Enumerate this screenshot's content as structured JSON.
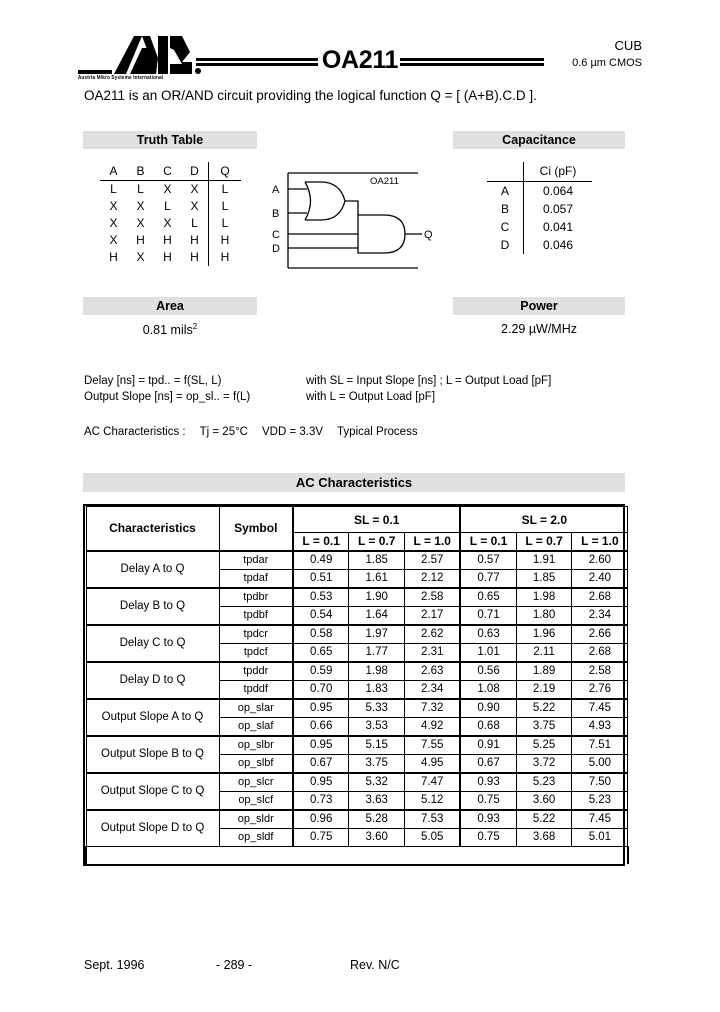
{
  "header": {
    "logo_alt": "AMS",
    "logo_subtitle": "Austria Mikro Systeme International",
    "part_number": "OA211",
    "family": "CUB",
    "process": "0.6 µm CMOS"
  },
  "intro": {
    "text": "OA211 is an OR/AND circuit providing the logical function Q = [ (A+B).C.D ]."
  },
  "sections": {
    "truth_table_title": "Truth Table",
    "capacitance_title": "Capacitance",
    "area_title": "Area",
    "power_title": "Power",
    "ac_title": "AC Characteristics"
  },
  "truth_table": {
    "headers": [
      "A",
      "B",
      "C",
      "D",
      "Q"
    ],
    "rows": [
      [
        "L",
        "L",
        "X",
        "X",
        "L"
      ],
      [
        "X",
        "X",
        "L",
        "X",
        "L"
      ],
      [
        "X",
        "X",
        "X",
        "L",
        "L"
      ],
      [
        "X",
        "H",
        "H",
        "H",
        "H"
      ],
      [
        "H",
        "X",
        "H",
        "H",
        "H"
      ]
    ]
  },
  "capacitance": {
    "value_header": "Ci (pF)",
    "rows": [
      {
        "pin": "A",
        "value": "0.064"
      },
      {
        "pin": "B",
        "value": "0.057"
      },
      {
        "pin": "C",
        "value": "0.041"
      },
      {
        "pin": "D",
        "value": "0.046"
      }
    ]
  },
  "circuit": {
    "label": "OA211",
    "inputs": [
      "A",
      "B",
      "C",
      "D"
    ],
    "output": "Q"
  },
  "area": {
    "value": "0.81  mils",
    "exponent": "2"
  },
  "power": {
    "value": "2.29 µW/MHz"
  },
  "notes": {
    "line1_left": "Delay [ns]  =  tpd..  =  f(SL, L)",
    "line1_right": "with  SL = Input Slope [ns] ;  L = Output Load [pF]",
    "line2_left": "Output Slope [ns]  =  op_sl..  =  f(L)",
    "line2_right": "with  L = Output Load [pF]",
    "ac_conditions_label": "AC Characteristics :",
    "ac_temp": "Tj = 25°C",
    "ac_vdd": "VDD = 3.3V",
    "ac_process": "Typical Process"
  },
  "ac_table": {
    "col_characteristics": "Characteristics",
    "col_symbol": "Symbol",
    "group1": "SL = 0.1",
    "group2": "SL = 2.0",
    "subcols": [
      "L = 0.1",
      "L = 0.7",
      "L = 1.0"
    ],
    "rows": [
      {
        "characteristic": "Delay A to Q",
        "sub": [
          {
            "symbol": "tpdar",
            "v": [
              "0.49",
              "1.85",
              "2.57",
              "0.57",
              "1.91",
              "2.60"
            ]
          },
          {
            "symbol": "tpdaf",
            "v": [
              "0.51",
              "1.61",
              "2.12",
              "0.77",
              "1.85",
              "2.40"
            ]
          }
        ]
      },
      {
        "characteristic": "Delay B to Q",
        "sub": [
          {
            "symbol": "tpdbr",
            "v": [
              "0.53",
              "1.90",
              "2.58",
              "0.65",
              "1.98",
              "2.68"
            ]
          },
          {
            "symbol": "tpdbf",
            "v": [
              "0.54",
              "1.64",
              "2.17",
              "0.71",
              "1.80",
              "2.34"
            ]
          }
        ]
      },
      {
        "characteristic": "Delay C to Q",
        "sub": [
          {
            "symbol": "tpdcr",
            "v": [
              "0.58",
              "1.97",
              "2.62",
              "0.63",
              "1.96",
              "2.66"
            ]
          },
          {
            "symbol": "tpdcf",
            "v": [
              "0.65",
              "1.77",
              "2.31",
              "1.01",
              "2.11",
              "2.68"
            ]
          }
        ]
      },
      {
        "characteristic": "Delay D to Q",
        "sub": [
          {
            "symbol": "tpddr",
            "v": [
              "0.59",
              "1.98",
              "2.63",
              "0.56",
              "1.89",
              "2.58"
            ]
          },
          {
            "symbol": "tpddf",
            "v": [
              "0.70",
              "1.83",
              "2.34",
              "1.08",
              "2.19",
              "2.76"
            ]
          }
        ]
      },
      {
        "characteristic": "Output Slope A to Q",
        "sub": [
          {
            "symbol": "op_slar",
            "v": [
              "0.95",
              "5.33",
              "7.32",
              "0.90",
              "5.22",
              "7.45"
            ]
          },
          {
            "symbol": "op_slaf",
            "v": [
              "0.66",
              "3.53",
              "4.92",
              "0.68",
              "3.75",
              "4.93"
            ]
          }
        ]
      },
      {
        "characteristic": "Output Slope B to Q",
        "sub": [
          {
            "symbol": "op_slbr",
            "v": [
              "0.95",
              "5.15",
              "7.55",
              "0.91",
              "5.25",
              "7.51"
            ]
          },
          {
            "symbol": "op_slbf",
            "v": [
              "0.67",
              "3.75",
              "4.95",
              "0.67",
              "3.72",
              "5.00"
            ]
          }
        ]
      },
      {
        "characteristic": "Output Slope C to Q",
        "sub": [
          {
            "symbol": "op_slcr",
            "v": [
              "0.95",
              "5.32",
              "7.47",
              "0.93",
              "5.23",
              "7.50"
            ]
          },
          {
            "symbol": "op_slcf",
            "v": [
              "0.73",
              "3.63",
              "5.12",
              "0.75",
              "3.60",
              "5.23"
            ]
          }
        ]
      },
      {
        "characteristic": "Output Slope D to Q",
        "sub": [
          {
            "symbol": "op_sldr",
            "v": [
              "0.96",
              "5.28",
              "7.53",
              "0.93",
              "5.22",
              "7.45"
            ]
          },
          {
            "symbol": "op_sldf",
            "v": [
              "0.75",
              "3.60",
              "5.05",
              "0.75",
              "3.68",
              "5.01"
            ]
          }
        ]
      }
    ]
  },
  "footer": {
    "date": "Sept. 1996",
    "page": "- 289 -",
    "revision": "Rev. N/C"
  }
}
